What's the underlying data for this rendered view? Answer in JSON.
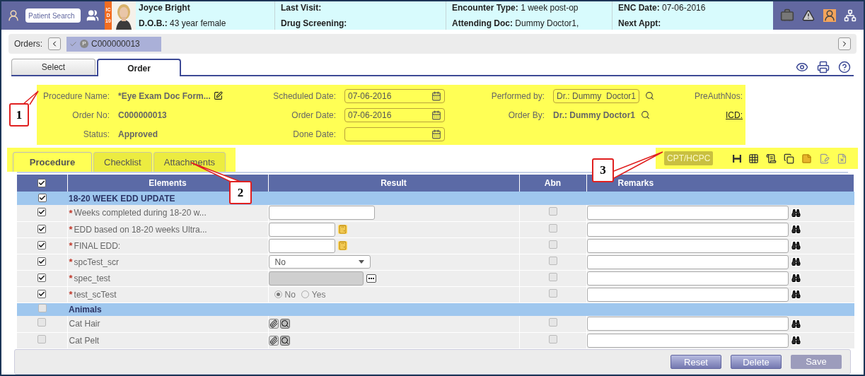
{
  "header": {
    "search": {
      "placeholder": "Patient Search"
    },
    "icd_badge": "ICD 10",
    "patient_name": "Joyce Bright",
    "dob": {
      "label": "D.O.B.:",
      "value": "43 year female"
    },
    "info_columns": [
      [
        {
          "label": "Last Visit:"
        },
        {
          "label": "Drug Screening:"
        }
      ],
      [
        {
          "label": "Encounter Type:",
          "value": "1 week post-op"
        },
        {
          "label": "Attending Doc:",
          "value": "Dummy Doctor1,"
        }
      ],
      [
        {
          "label": "ENC Date:",
          "value": "07-06-2016"
        },
        {
          "label": "Next Appt:"
        }
      ]
    ]
  },
  "orders": {
    "label": "Orders:",
    "items": [
      {
        "badge": "P",
        "text": "C000000013",
        "selected": true
      }
    ]
  },
  "main_tabs": [
    {
      "label": "Select",
      "selected": false
    },
    {
      "label": "Order",
      "selected": true
    }
  ],
  "form": {
    "highlighted": true,
    "rows": [
      [
        {
          "kind": "text_edit",
          "label": "Procedure Name:",
          "value": "*Eye Exam Doc Form..."
        },
        {
          "kind": "date",
          "label": "Scheduled Date:",
          "value": "07-06-2016"
        },
        {
          "kind": "lookup_field",
          "label": "Performed by:",
          "value": "Dr.: Dummy  Doctor1"
        },
        {
          "kind": "label",
          "label": "PreAuthNos:"
        }
      ],
      [
        {
          "kind": "text",
          "label": "Order No:",
          "value": "C000000013"
        },
        {
          "kind": "date",
          "label": "Order Date:",
          "value": "07-06-2016"
        },
        {
          "kind": "lookup_text",
          "label": "Order By:",
          "value": "Dr.: Dummy Doctor1"
        },
        {
          "kind": "link",
          "label": "ICD:"
        }
      ],
      [
        {
          "kind": "text",
          "label": "Status:",
          "value": "Approved"
        },
        {
          "kind": "date",
          "label": "Done Date:"
        }
      ]
    ]
  },
  "sub_tabs": {
    "highlighted": true,
    "items": [
      {
        "label": "Procedure",
        "selected": true
      },
      {
        "label": "Checklist",
        "selected": false
      },
      {
        "label": "Attachments",
        "selected": false
      }
    ]
  },
  "toolbar": {
    "highlighted": true,
    "button": {
      "label": "CPT/HCPC",
      "disabled": true
    }
  },
  "table": {
    "header_checked": true,
    "required_mark": "*",
    "columns": [
      "Elements",
      "Result",
      "Abn",
      "Remarks"
    ],
    "rows": [
      {
        "kind": "group",
        "label": "18-20 WEEK EDD UPDATE",
        "checked": true
      },
      {
        "kind": "item",
        "label": "Weeks completed during 18-20 w...",
        "required": true,
        "checked": true,
        "result": {
          "kind": "text"
        },
        "abn": false
      },
      {
        "kind": "item",
        "label": "EDD based on 18-20 weeks Ultra...",
        "required": true,
        "checked": true,
        "result": {
          "kind": "calc"
        },
        "abn": false
      },
      {
        "kind": "item",
        "label": "FINAL EDD:",
        "required": true,
        "checked": true,
        "result": {
          "kind": "calc"
        },
        "abn": false
      },
      {
        "kind": "item",
        "label": "spcTest_scr",
        "required": true,
        "checked": true,
        "result": {
          "kind": "select",
          "value": "No"
        },
        "abn": false
      },
      {
        "kind": "item",
        "label": "spec_test",
        "required": true,
        "checked": true,
        "result": {
          "kind": "lookup"
        },
        "abn": false
      },
      {
        "kind": "item",
        "label": "test_scTest",
        "required": true,
        "checked": true,
        "result": {
          "kind": "radio",
          "options": [
            {
              "label": "No",
              "selected": true
            },
            {
              "label": "Yes",
              "selected": false
            }
          ]
        },
        "abn": false
      },
      {
        "kind": "group",
        "label": "Animals",
        "checked": false
      },
      {
        "kind": "item",
        "label": "Cat Hair",
        "required": false,
        "checked": false,
        "result": {
          "kind": "attach"
        },
        "abn": false
      },
      {
        "kind": "item",
        "label": "Cat Pelt",
        "required": false,
        "checked": false,
        "result": {
          "kind": "attach"
        },
        "abn": false
      }
    ]
  },
  "buttons": [
    {
      "label": "Reset",
      "disabled": false
    },
    {
      "label": "Delete",
      "disabled": false
    },
    {
      "label": "Save",
      "disabled": true
    }
  ],
  "callouts": [
    {
      "label": "1"
    },
    {
      "label": "2"
    },
    {
      "label": "3"
    }
  ]
}
